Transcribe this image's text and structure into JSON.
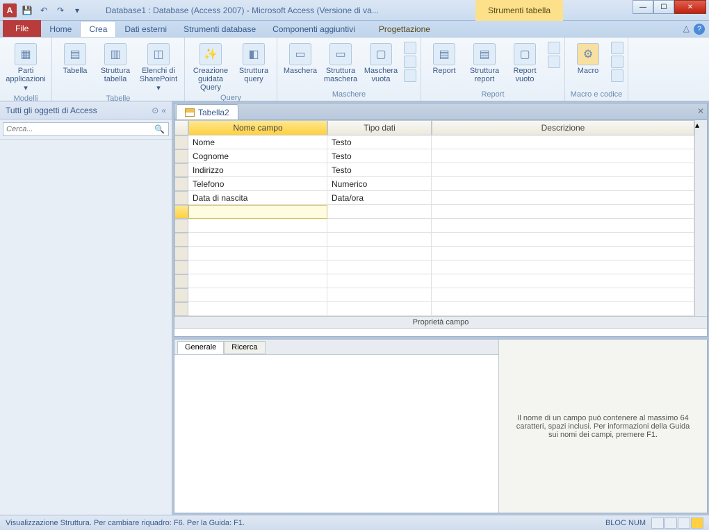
{
  "title": "Database1 : Database (Access 2007) - Microsoft Access (Versione di va...",
  "context_tab_title": "Strumenti tabella",
  "tabs": {
    "file": "File",
    "home": "Home",
    "crea": "Crea",
    "dati": "Dati esterni",
    "strumenti": "Strumenti database",
    "componenti": "Componenti aggiuntivi",
    "progettazione": "Progettazione"
  },
  "ribbon": {
    "modelli": {
      "label": "Modelli",
      "parti": "Parti applicazioni"
    },
    "tabelle": {
      "label": "Tabelle",
      "tabella": "Tabella",
      "struttura": "Struttura tabella",
      "elenchi": "Elenchi di SharePoint"
    },
    "query": {
      "label": "Query",
      "creazione": "Creazione guidata Query",
      "struttura": "Struttura query"
    },
    "maschere": {
      "label": "Maschere",
      "maschera": "Maschera",
      "struttura": "Struttura maschera",
      "vuota": "Maschera vuota"
    },
    "report": {
      "label": "Report",
      "report": "Report",
      "struttura": "Struttura report",
      "vuoto": "Report vuoto"
    },
    "macro": {
      "label": "Macro e codice",
      "macro": "Macro"
    }
  },
  "nav": {
    "title": "Tutti gli oggetti di Access",
    "search_placeholder": "Cerca..."
  },
  "doc": {
    "tab": "Tabella2",
    "columns": {
      "name": "Nome campo",
      "type": "Tipo dati",
      "desc": "Descrizione"
    },
    "rows": [
      {
        "name": "Nome",
        "type": "Testo",
        "desc": ""
      },
      {
        "name": "Cognome",
        "type": "Testo",
        "desc": ""
      },
      {
        "name": "Indirizzo",
        "type": "Testo",
        "desc": ""
      },
      {
        "name": "Telefono",
        "type": "Numerico",
        "desc": ""
      },
      {
        "name": "Data di nascita",
        "type": "Data/ora",
        "desc": ""
      }
    ],
    "prop_label": "Proprietà campo",
    "prop_tabs": {
      "generale": "Generale",
      "ricerca": "Ricerca"
    },
    "hint": "Il nome di un campo può contenere al massimo 64 caratteri, spazi inclusi. Per informazioni della Guida sui nomi dei campi, premere F1."
  },
  "status": {
    "left": "Visualizzazione Struttura. Per cambiare riquadro: F6. Per la Guida: F1.",
    "numlock": "BLOC NUM"
  }
}
